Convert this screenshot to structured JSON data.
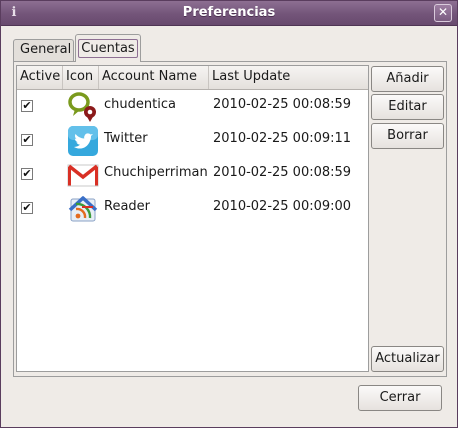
{
  "window": {
    "title": "Preferencias",
    "close_label": "✕"
  },
  "tabs": [
    {
      "label": "General",
      "active": false
    },
    {
      "label": "Cuentas",
      "active": true
    }
  ],
  "accounts_table": {
    "columns": [
      "Active",
      "Icon",
      "Account Name",
      "Last Update"
    ],
    "rows": [
      {
        "active": true,
        "icon": "identica-icon",
        "name": "chudentica",
        "last_update": "2010-02-25 00:08:59"
      },
      {
        "active": true,
        "icon": "twitter-icon",
        "name": "Twitter",
        "last_update": "2010-02-25 00:09:11"
      },
      {
        "active": true,
        "icon": "gmail-icon",
        "name": "Chuchiperriman",
        "last_update": "2010-02-25 00:08:59"
      },
      {
        "active": true,
        "icon": "google-reader-icon",
        "name": "Reader",
        "last_update": "2010-02-25 00:09:00"
      }
    ]
  },
  "buttons": {
    "add": "Añadir",
    "edit": "Editar",
    "delete": "Borrar",
    "update": "Actualizar",
    "close": "Cerrar"
  },
  "colors": {
    "titlebar": "#735479",
    "window_bg": "#efebe7",
    "check_mark": "✔"
  }
}
